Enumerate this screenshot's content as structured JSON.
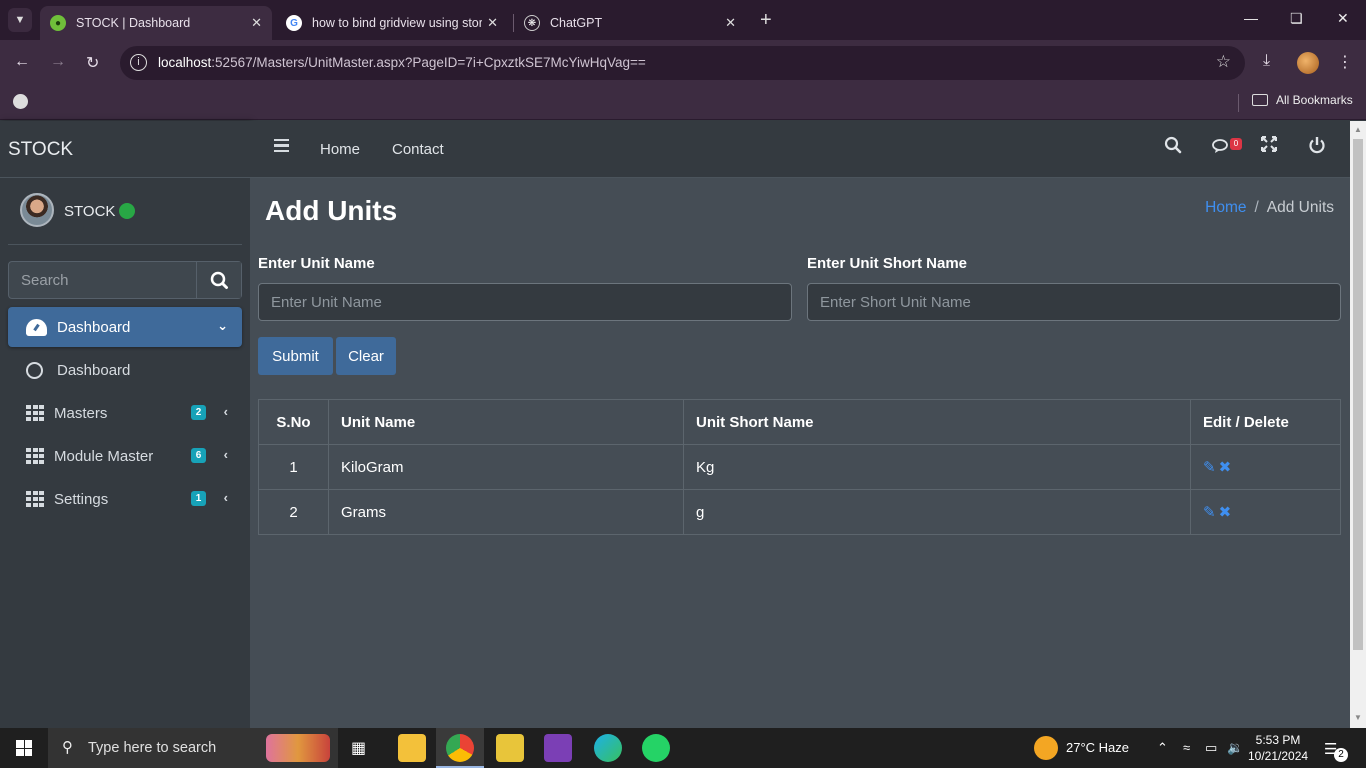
{
  "browser": {
    "tabs": [
      {
        "title": "STOCK | Dashboard",
        "active": true
      },
      {
        "title": "how to bind gridview using stor",
        "active": false
      },
      {
        "title": "ChatGPT",
        "active": false
      }
    ],
    "url_host": "localhost",
    "url_path": ":52567/Masters/UnitMaster.aspx?PageID=7i+CpxztkSE7McYiwHqVag==",
    "bookmarks_label": "All Bookmarks"
  },
  "app": {
    "brand": "STOCK",
    "user_name": "STOCK",
    "sidebar_search_placeholder": "Search",
    "menu": [
      {
        "label": "Dashboard",
        "icon": "dashboard-gauge-icon",
        "active": true
      },
      {
        "label": "Dashboard",
        "icon": "circle-icon",
        "active": false
      },
      {
        "label": "Masters",
        "icon": "grid-icon",
        "badge": "2"
      },
      {
        "label": "Module Master",
        "icon": "grid-icon",
        "badge": "6"
      },
      {
        "label": "Settings",
        "icon": "grid-icon",
        "badge": "1"
      }
    ],
    "topnav": {
      "home": "Home",
      "contact": "Contact",
      "notifications_count": "0"
    },
    "page_title": "Add Units",
    "breadcrumb": {
      "home": "Home",
      "separator": "/",
      "current": "Add Units"
    },
    "form": {
      "unit_name_label": "Enter Unit Name",
      "unit_name_placeholder": "Enter Unit Name",
      "short_name_label": "Enter Unit Short Name",
      "short_name_placeholder": "Enter Short Unit Name",
      "submit_label": "Submit",
      "clear_label": "Clear"
    },
    "table": {
      "headers": [
        "S.No",
        "Unit Name",
        "Unit Short Name",
        "Edit / Delete"
      ],
      "rows": [
        {
          "sno": "1",
          "unit_name": "KiloGram",
          "short_name": "Kg"
        },
        {
          "sno": "2",
          "unit_name": "Grams",
          "short_name": "g"
        }
      ]
    }
  },
  "taskbar": {
    "search_placeholder": "Type here to search",
    "weather": "27°C  Haze",
    "time": "5:53 PM",
    "date": "10/21/2024",
    "notification_count": "2"
  },
  "colors": {
    "primary_button": "#3f6a9a",
    "link": "#3f8ff0",
    "online": "#28a745",
    "badge": "#17a2b8"
  }
}
